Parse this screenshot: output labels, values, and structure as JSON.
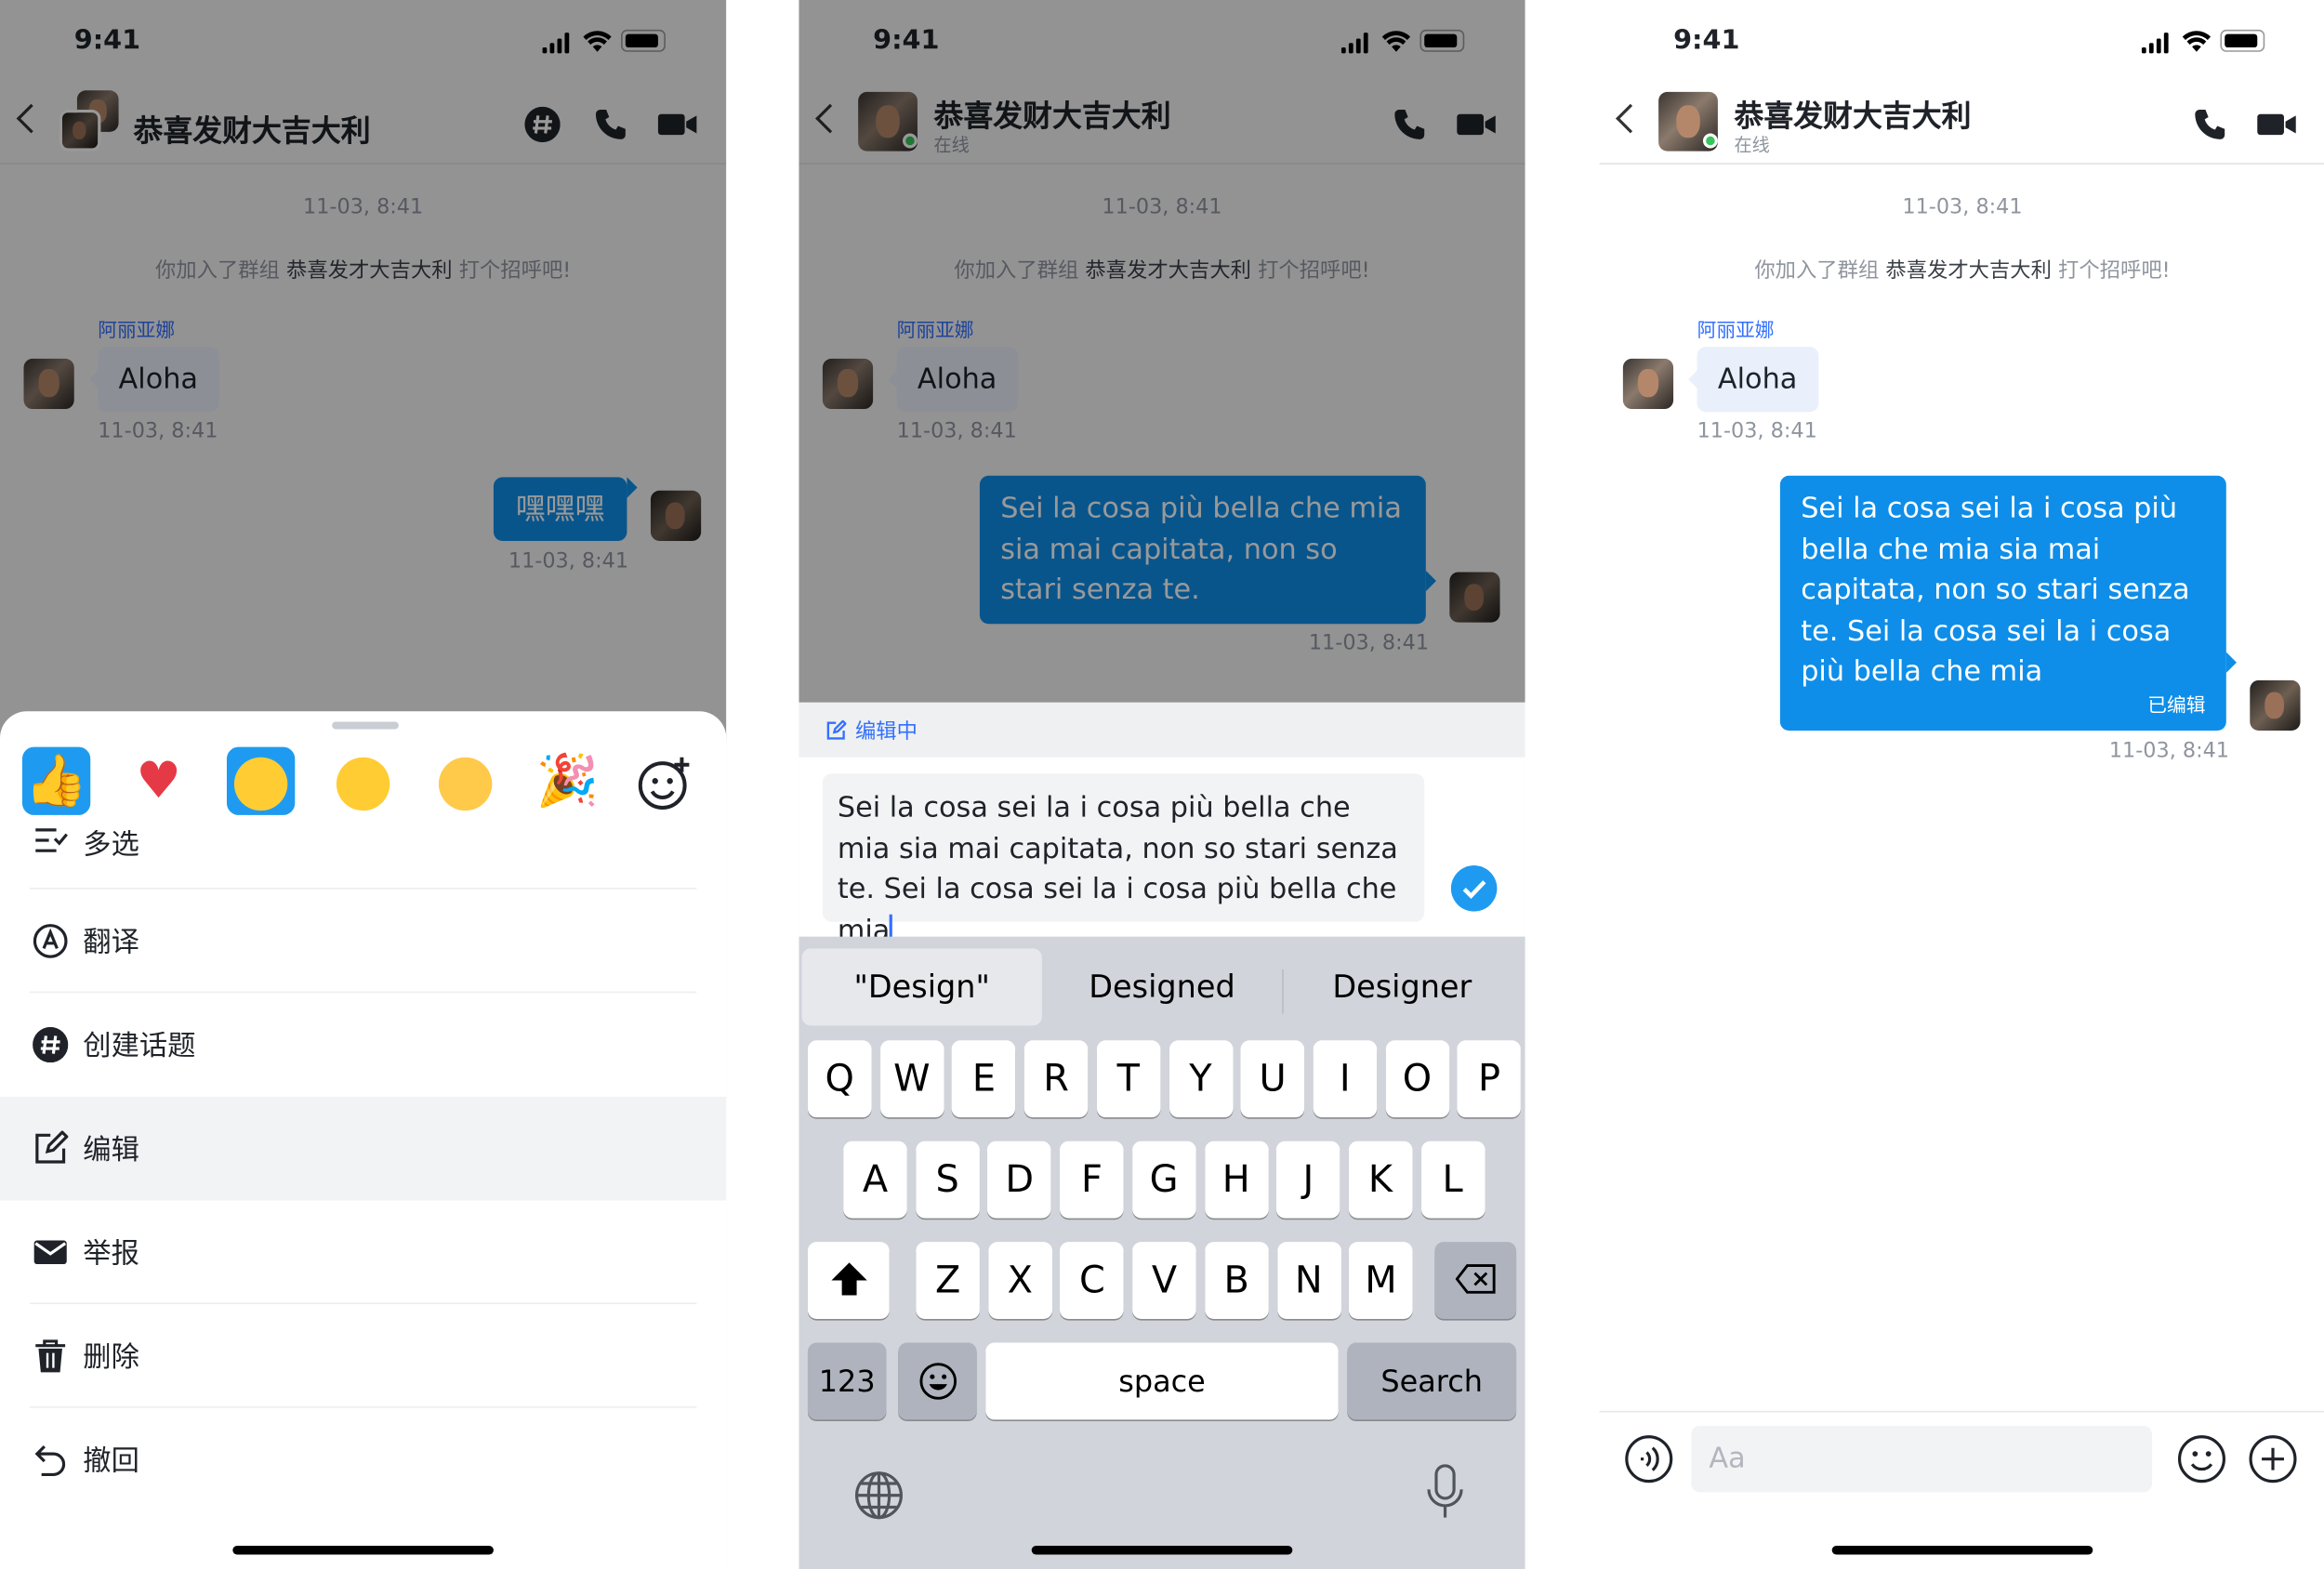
{
  "status": {
    "time": "9:41"
  },
  "chat": {
    "title": "恭喜发财大吉大利",
    "presence": "在线",
    "timestamp": "11-03, 8:41",
    "system_prefix": "你加入了群组",
    "system_group": "恭喜发才大吉大利",
    "system_suffix": "打个招呼吧!",
    "sender_name": "阿丽亚娜",
    "incoming_text": "Aloha",
    "incoming_time": "11-03, 8:41"
  },
  "screen1": {
    "outgoing_text": "嘿嘿嘿",
    "outgoing_time": "11-03, 8:41",
    "reactions": [
      "thumbs-up",
      "red-heart",
      "winking-face",
      "face-with-raised-eyebrow",
      "loudly-crying-face",
      "party-popper",
      "add-reaction"
    ],
    "menu": [
      {
        "label": "多选",
        "icon": "multi-select-icon"
      },
      {
        "label": "翻译",
        "icon": "translate-icon"
      },
      {
        "label": "创建话题",
        "icon": "hashtag-icon"
      },
      {
        "label": "编辑",
        "icon": "edit-icon"
      },
      {
        "label": "举报",
        "icon": "mail-icon"
      },
      {
        "label": "删除",
        "icon": "trash-icon"
      },
      {
        "label": "撤回",
        "icon": "undo-icon"
      }
    ]
  },
  "screen2": {
    "outgoing_text": "Sei la cosa più bella che mia sia mai capitata, non so stari senza te.",
    "outgoing_time": "11-03, 8:41",
    "editing_label": "编辑中",
    "input_value": "Sei la cosa sei la i cosa più bella che mia sia mai capitata, non so stari senza te. Sei la cosa sei la i cosa più bella che mia",
    "suggestions": [
      "\"Design\"",
      "Designed",
      "Designer"
    ],
    "keyboard_rows": [
      [
        "Q",
        "W",
        "E",
        "R",
        "T",
        "Y",
        "U",
        "I",
        "O",
        "P"
      ],
      [
        "A",
        "S",
        "D",
        "F",
        "G",
        "H",
        "J",
        "K",
        "L"
      ],
      [
        "Z",
        "X",
        "C",
        "V",
        "B",
        "N",
        "M"
      ]
    ],
    "key_123": "123",
    "key_space": "space",
    "key_search": "Search"
  },
  "screen3": {
    "outgoing_text": "Sei la cosa sei la i cosa più bella che mia sia mai capitata, non so stari senza te. Sei la cosa sei la i cosa più bella che mia",
    "edited_label": "已编辑",
    "outgoing_time": "11-03, 8:41",
    "input_placeholder": "Aa"
  },
  "colors": {
    "accent": "#0e8ee9",
    "link": "#3370ff",
    "online": "#34c759"
  }
}
